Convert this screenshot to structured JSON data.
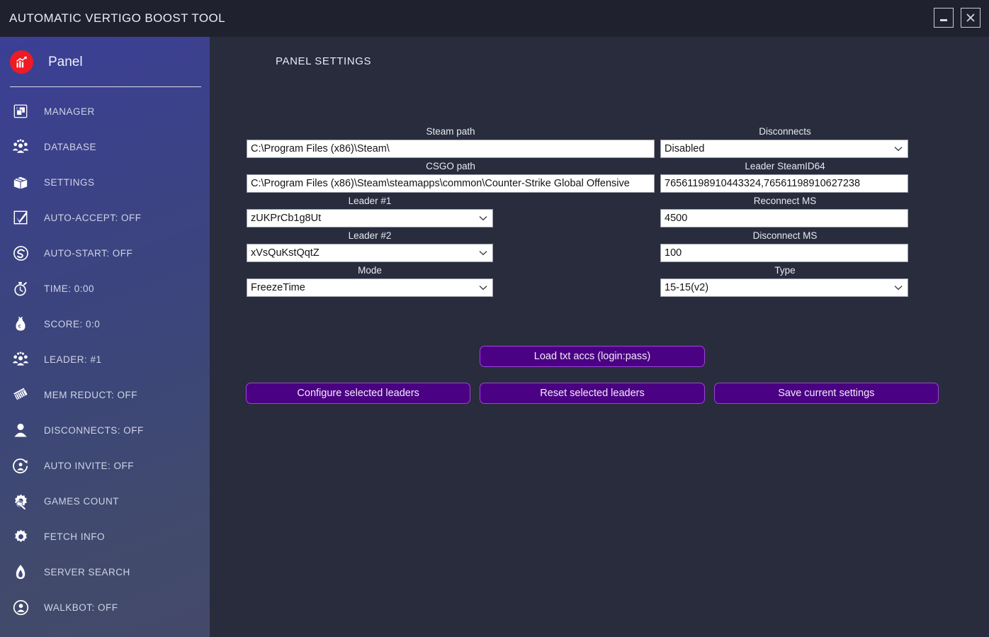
{
  "window": {
    "title": "AUTOMATIC VERTIGO BOOST TOOL",
    "minimize_label": "minimize",
    "close_label": "close"
  },
  "sidebar": {
    "panel": {
      "label": "Panel",
      "icon": "chart-growth-icon"
    },
    "items": [
      {
        "label": "MANAGER",
        "icon": "window-stack-icon"
      },
      {
        "label": "DATABASE",
        "icon": "users-group-icon"
      },
      {
        "label": "SETTINGS",
        "icon": "box-package-icon"
      },
      {
        "label": "AUTO-ACCEPT: OFF",
        "icon": "checkbox-checked-icon"
      },
      {
        "label": "AUTO-START: OFF",
        "icon": "refresh-circle-icon"
      },
      {
        "label": "TIME: 0:00",
        "icon": "stopwatch-icon"
      },
      {
        "label": "SCORE: 0:0",
        "icon": "money-bag-icon"
      },
      {
        "label": "LEADER: #1",
        "icon": "users-group-icon"
      },
      {
        "label": "MEM REDUCT: OFF",
        "icon": "memory-chip-icon"
      },
      {
        "label": "DISCONNECTS: OFF",
        "icon": "person-icon"
      },
      {
        "label": "AUTO INVITE: OFF",
        "icon": "invite-circle-icon"
      },
      {
        "label": "GAMES COUNT",
        "icon": "gear-search-icon"
      },
      {
        "label": "FETCH INFO",
        "icon": "gear-icon"
      },
      {
        "label": "SERVER SEARCH",
        "icon": "flame-icon"
      },
      {
        "label": "WALKBOT: OFF",
        "icon": "person-circle-icon"
      }
    ]
  },
  "main": {
    "title": "PANEL SETTINGS",
    "fields": {
      "steam_path": {
        "label": "Steam path",
        "value": "C:\\Program Files (x86)\\Steam\\"
      },
      "disconnects": {
        "label": "Disconnects",
        "value": "Disabled"
      },
      "csgo_path": {
        "label": "CSGO path",
        "value": "C:\\Program Files (x86)\\Steam\\steamapps\\common\\Counter-Strike Global Offensive"
      },
      "leader_steamid64": {
        "label": "Leader SteamID64",
        "value": "76561198910443324,76561198910627238"
      },
      "leader_1": {
        "label": "Leader #1",
        "value": "zUKPrCb1g8Ut"
      },
      "reconnect_ms": {
        "label": "Reconnect MS",
        "value": "4500"
      },
      "leader_2": {
        "label": "Leader #2",
        "value": "xVsQuKstQqtZ"
      },
      "disconnect_ms": {
        "label": "Disconnect MS",
        "value": "100"
      },
      "mode": {
        "label": "Mode",
        "value": "FreezeTime"
      },
      "type": {
        "label": "Type",
        "value": "15-15(v2)"
      }
    },
    "buttons": {
      "load_txt": "Load txt accs (login:pass)",
      "configure": "Configure selected leaders",
      "reset": "Reset selected leaders",
      "save": "Save current settings"
    }
  },
  "colors": {
    "titlebar_bg": "#1f212e",
    "content_bg": "#282c3c",
    "sidebar_top": "#3b3f96",
    "sidebar_bottom": "#44496a",
    "button_fill": "#4b0183",
    "button_border": "#9b45d6",
    "panel_icon_bg": "#ee1b24",
    "input_bg": "#ffffff",
    "label_text": "#e6e9f3"
  }
}
